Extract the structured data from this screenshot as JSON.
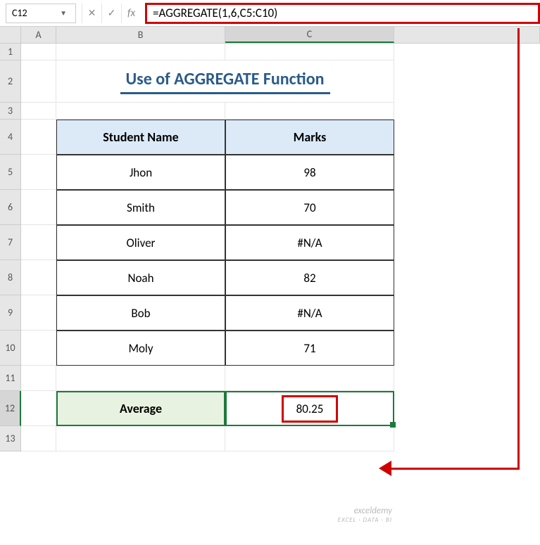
{
  "nameBox": "C12",
  "formula": "=AGGREGATE(1,6,C5:C10)",
  "columns": {
    "A": "A",
    "B": "B",
    "C": "C"
  },
  "rows": [
    "1",
    "2",
    "3",
    "4",
    "5",
    "6",
    "7",
    "8",
    "9",
    "10",
    "11",
    "12",
    "13"
  ],
  "title": "Use of AGGREGATE Function",
  "table": {
    "headers": {
      "name": "Student Name",
      "marks": "Marks"
    },
    "rows": [
      {
        "name": "Jhon",
        "marks": "98"
      },
      {
        "name": "Smith",
        "marks": "70"
      },
      {
        "name": "Oliver",
        "marks": "#N/A"
      },
      {
        "name": "Noah",
        "marks": "82"
      },
      {
        "name": "Bob",
        "marks": "#N/A"
      },
      {
        "name": "Moly",
        "marks": "71"
      }
    ]
  },
  "summary": {
    "label": "Average",
    "value": "80.25"
  },
  "watermark": {
    "brand": "exceldemy",
    "tagline": "EXCEL · DATA · BI"
  }
}
